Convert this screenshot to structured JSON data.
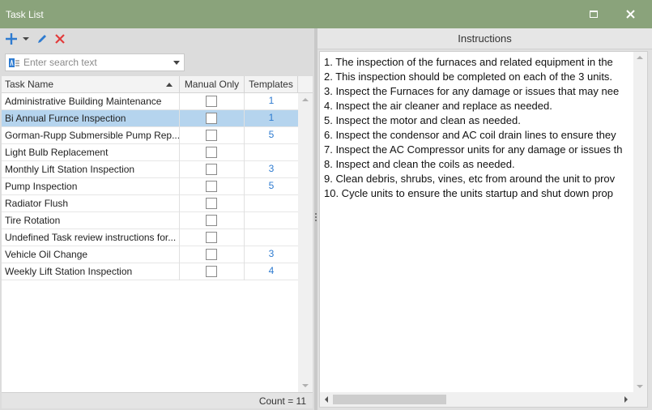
{
  "window": {
    "title": "Task List"
  },
  "colors": {
    "titlebar": "#8aa37b",
    "accent_blue": "#2e7bd0",
    "delete_red": "#e23b3b",
    "selected_row": "#b5d4ee"
  },
  "toolbar": {
    "add_icon": "plus-icon",
    "edit_icon": "pencil-icon",
    "delete_icon": "x-icon"
  },
  "search": {
    "placeholder": "Enter search text",
    "value": ""
  },
  "grid": {
    "columns": [
      "Task Name",
      "Manual Only",
      "Templates"
    ],
    "sort_column": "Task Name",
    "sort_direction": "ascending",
    "rows": [
      {
        "name": "Administrative Building Maintenance",
        "manual_only": false,
        "templates": "1",
        "selected": false
      },
      {
        "name": "Bi Annual Furnce Inspection",
        "manual_only": false,
        "templates": "1",
        "selected": true
      },
      {
        "name": "Gorman-Rupp Submersible Pump Rep...",
        "manual_only": false,
        "templates": "5",
        "selected": false
      },
      {
        "name": "Light Bulb Replacement",
        "manual_only": false,
        "templates": "",
        "selected": false
      },
      {
        "name": "Monthly Lift Station Inspection",
        "manual_only": false,
        "templates": "3",
        "selected": false
      },
      {
        "name": "Pump Inspection",
        "manual_only": false,
        "templates": "5",
        "selected": false
      },
      {
        "name": "Radiator Flush",
        "manual_only": false,
        "templates": "",
        "selected": false
      },
      {
        "name": "Tire Rotation",
        "manual_only": false,
        "templates": "",
        "selected": false
      },
      {
        "name": "Undefined Task review instructions for...",
        "manual_only": false,
        "templates": "",
        "selected": false
      },
      {
        "name": "Vehicle Oil Change",
        "manual_only": false,
        "templates": "3",
        "selected": false
      },
      {
        "name": "Weekly Lift Station Inspection",
        "manual_only": false,
        "templates": "4",
        "selected": false
      }
    ],
    "footer_count": "Count = 11"
  },
  "instructions": {
    "header": "Instructions",
    "lines": [
      "1. The inspection of the furnaces and related equipment in the",
      "2. This inspection should be completed on each of the 3 units.",
      "3. Inspect the Furnaces for any damage or issues that may nee",
      "4. Inspect the air cleaner and replace as needed.",
      "5. Inspect the motor and clean as needed.",
      "6. Inspect the condensor and AC coil drain lines to ensure they",
      "7. Inspect the AC Compressor units for any damage or issues th",
      "8. Inspect and clean the coils as needed.",
      "9. Clean debris, shrubs, vines, etc from around the unit to prov",
      "10. Cycle units to ensure the units startup and shut down prop"
    ]
  }
}
